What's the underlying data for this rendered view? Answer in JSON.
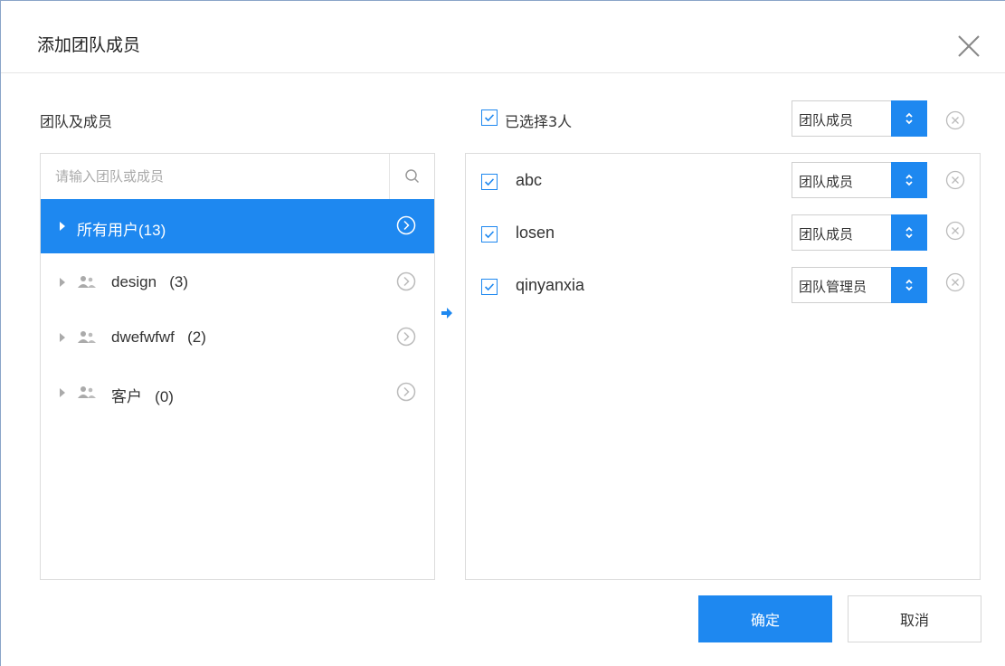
{
  "dialog": {
    "title": "添加团队成员"
  },
  "left": {
    "section_label": "团队及成员",
    "search_placeholder": "请输入团队或成员",
    "tree": [
      {
        "label": "所有用户(13)",
        "active": true,
        "group_icon": false
      },
      {
        "label": "design   (3)",
        "active": false,
        "group_icon": true
      },
      {
        "label": "dwefwfwf   (2)",
        "active": false,
        "group_icon": true
      },
      {
        "label": "客户   (0)",
        "active": false,
        "group_icon": true
      }
    ]
  },
  "right": {
    "selected_label": "已选择3人",
    "bulk_role": "团队成员",
    "members": [
      {
        "name": "abc",
        "role": "团队成员"
      },
      {
        "name": "losen",
        "role": "团队成员"
      },
      {
        "name": "qinyanxia",
        "role": "团队管理员"
      }
    ]
  },
  "buttons": {
    "confirm": "确定",
    "cancel": "取消"
  },
  "colors": {
    "accent": "#1e88f0",
    "border": "#dcdcdc"
  }
}
